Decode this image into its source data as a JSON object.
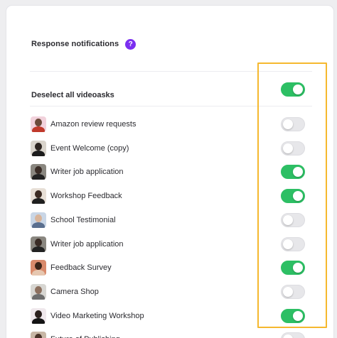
{
  "header": {
    "title": "Response notifications",
    "help_icon": "?"
  },
  "deselect": {
    "label": "Deselect all videoasks",
    "on": true
  },
  "items": [
    {
      "label": "Amazon review requests",
      "on": false,
      "avatar": {
        "bg": "#f2d2dc",
        "head": "#6b4a3a",
        "body": "#c0392b"
      }
    },
    {
      "label": "Event Welcome (copy)",
      "on": false,
      "avatar": {
        "bg": "#d9d4cc",
        "head": "#2c2420",
        "body": "#1c1c1c"
      }
    },
    {
      "label": "Writer job application",
      "on": true,
      "avatar": {
        "bg": "#8a8780",
        "head": "#3a2c26",
        "body": "#222222"
      }
    },
    {
      "label": "Workshop Feedback",
      "on": true,
      "avatar": {
        "bg": "#e7dfd6",
        "head": "#3b2a22",
        "body": "#1f1f1f"
      }
    },
    {
      "label": "School Testimonial",
      "on": false,
      "avatar": {
        "bg": "#c9d6e6",
        "head": "#d8b49a",
        "body": "#5a6f8f"
      }
    },
    {
      "label": "Writer job application",
      "on": false,
      "avatar": {
        "bg": "#8a8780",
        "head": "#3a2c26",
        "body": "#222222"
      }
    },
    {
      "label": "Feedback Survey",
      "on": true,
      "avatar": {
        "bg": "#d98a6b",
        "head": "#3b2418",
        "body": "#e6c7b0"
      }
    },
    {
      "label": "Camera Shop",
      "on": false,
      "avatar": {
        "bg": "#d7d6d2",
        "head": "#8c6f5e",
        "body": "#6d6d6d"
      }
    },
    {
      "label": "Video Marketing Workshop",
      "on": true,
      "avatar": {
        "bg": "#efe8ec",
        "head": "#2a1f1c",
        "body": "#141414"
      }
    },
    {
      "label": "Future of Publishing",
      "on": false,
      "avatar": {
        "bg": "#c8b7a6",
        "head": "#4a3429",
        "body": "#333333"
      }
    }
  ],
  "colors": {
    "toggle_on": "#2dbf64",
    "highlight": "#f5b82e",
    "help": "#7b2ff0"
  }
}
